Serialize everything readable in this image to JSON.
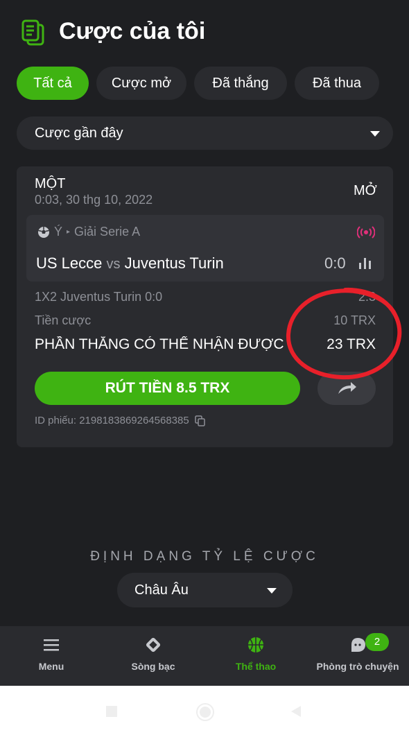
{
  "header": {
    "title": "Cược của tôi",
    "icon": "document-icon"
  },
  "tabs": [
    {
      "label": "Tất cả",
      "active": true
    },
    {
      "label": "Cược mở",
      "active": false
    },
    {
      "label": "Đã thắng",
      "active": false
    },
    {
      "label": "Đã thua",
      "active": false
    }
  ],
  "filter": {
    "selected": "Cược gần đây"
  },
  "bet": {
    "type": "MỘT",
    "datetime": "0:03, 30 thg 10, 2022",
    "status": "MỞ",
    "league": {
      "country": "Ý",
      "name": "Giải Serie A",
      "sport_icon": "soccer-ball-icon"
    },
    "home": "US Lecce",
    "vs": "vs",
    "away": "Juventus Turin",
    "score": "0:0",
    "selection": "1X2 Juventus Turin  0:0",
    "odds": "2.3",
    "stake_label": "Tiền cược",
    "stake_value": "10 TRX",
    "win_label": "PHẦN THẮNG CÓ THỂ NHẬN ĐƯỢC",
    "win_value": "23 TRX",
    "cashout_label": "RÚT TIỀN 8.5 TRX",
    "ticket_id": "ID phiếu: 2198183869264568385"
  },
  "odds_format": {
    "title": "ĐỊNH DẠNG TỶ LỆ CƯỢC",
    "selected": "Châu Âu"
  },
  "nav": [
    {
      "label": "Menu",
      "icon": "menu-icon"
    },
    {
      "label": "Sòng bạc",
      "icon": "casino-icon"
    },
    {
      "label": "Thể thao",
      "icon": "basketball-icon",
      "active": true
    },
    {
      "label": "Phòng trò chuyện",
      "icon": "chat-icon",
      "badge": "2"
    }
  ],
  "colors": {
    "accent": "#3fb312",
    "background": "#1e1f22",
    "card": "#2a2b2f",
    "live": "#e0307a",
    "highlight": "#e8202a"
  }
}
